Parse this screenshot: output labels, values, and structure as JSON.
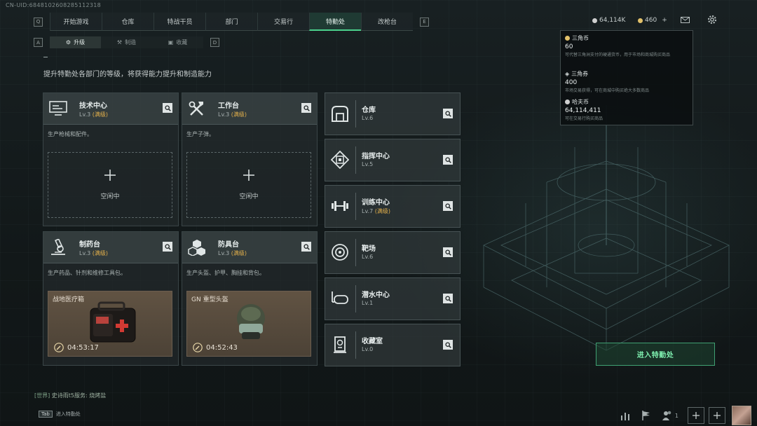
{
  "uid": "CN-UID:6848102608285112318",
  "nav": {
    "key_left": "Q",
    "key_right": "E",
    "tabs": [
      {
        "label": "开始游戏",
        "active": false
      },
      {
        "label": "仓库",
        "active": false
      },
      {
        "label": "特战干员",
        "active": false
      },
      {
        "label": "部门",
        "active": false
      },
      {
        "label": "交易行",
        "active": false
      },
      {
        "label": "特勤处",
        "active": true
      },
      {
        "label": "改枪台",
        "active": false
      }
    ]
  },
  "currency": {
    "coins": "64,114K",
    "gold": "460",
    "gold_plus": "+"
  },
  "subnav": {
    "key_left": "A",
    "key_right": "D",
    "tabs": [
      {
        "label": "升级",
        "active": true,
        "icon": "upgrade-icon"
      },
      {
        "label": "制造",
        "active": false,
        "icon": "craft-icon"
      },
      {
        "label": "收藏",
        "active": false,
        "icon": "collection-icon"
      }
    ]
  },
  "page": {
    "title": "...",
    "description": "提升特勤处各部门的等级，将获得能力提升和制造能力"
  },
  "workshops": [
    {
      "name": "技术中心",
      "level": "Lv.3",
      "max": "(满级)",
      "desc": "生产枪械和配件。",
      "state": "idle",
      "idle_text": "空闲中",
      "icon": "monitor-icon"
    },
    {
      "name": "工作台",
      "level": "Lv.3",
      "max": "(满级)",
      "desc": "生产子弹。",
      "state": "idle",
      "idle_text": "空闲中",
      "icon": "tools-icon"
    },
    {
      "name": "制药台",
      "level": "Lv.3",
      "max": "(满级)",
      "desc": "生产药品、针剂和维修工具包。",
      "state": "producing",
      "item": "战地医疗箱",
      "time": "04:53:17",
      "icon": "microscope-icon"
    },
    {
      "name": "防具台",
      "level": "Lv.3",
      "max": "(满级)",
      "desc": "生产头盔、护甲、胸挂和背包。",
      "state": "producing",
      "item": "GN 重型头盔",
      "time": "04:52:43",
      "icon": "armor-boxes-icon"
    }
  ],
  "facilities": [
    {
      "name": "仓库",
      "level": "Lv.6",
      "max": "",
      "icon": "warehouse-icon"
    },
    {
      "name": "指挥中心",
      "level": "Lv.5",
      "max": "",
      "icon": "chip-icon"
    },
    {
      "name": "训练中心",
      "level": "Lv.7",
      "max": "(满级)",
      "icon": "dumbbell-icon"
    },
    {
      "name": "靶场",
      "level": "Lv.6",
      "max": "",
      "icon": "target-icon"
    },
    {
      "name": "潜水中心",
      "level": "Lv.1",
      "max": "",
      "icon": "diving-mask-icon"
    },
    {
      "name": "收藏室",
      "level": "Lv.0",
      "max": "",
      "icon": "trophy-icon"
    }
  ],
  "tooltip": {
    "items": [
      {
        "name": "三角币",
        "value": "60",
        "desc": "可代替三角洲支付的硬通货币，用于市场和商城购买商品"
      },
      {
        "name": "三角券",
        "value": "400",
        "desc": "市场交易获得，可在商城中购买绝大多数商品"
      },
      {
        "name": "哈夫币",
        "value": "64,114,411",
        "desc": "可在交易行购买商品"
      }
    ]
  },
  "enter_button": "进入特勤处",
  "chat": {
    "channel": "[世界]",
    "text": "史诗雨t5服务: 烧烤盐"
  },
  "tab_hint": {
    "key": "Tab",
    "label": "进入特勤处"
  },
  "bottom": {
    "friends_count": "1"
  },
  "colors": {
    "accent": "#4bd18c",
    "max_level": "#e3b04b",
    "brand_green": "#7ff0b0"
  }
}
